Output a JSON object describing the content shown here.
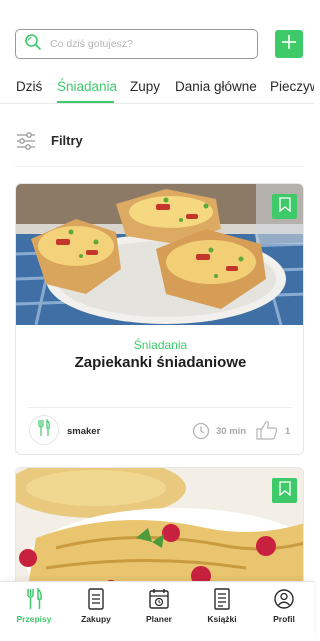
{
  "colors": {
    "accent": "#3fca6a",
    "text": "#222222",
    "muted": "#a8a8a8"
  },
  "search": {
    "placeholder": "Co dziś gotujesz?",
    "icon": "search-icon"
  },
  "header": {
    "add_icon": "plus-icon"
  },
  "tabs": [
    {
      "label": "Dziś",
      "active": false
    },
    {
      "label": "Śniadania",
      "active": true
    },
    {
      "label": "Zupy",
      "active": false
    },
    {
      "label": "Dania główne",
      "active": false
    },
    {
      "label": "Pieczywo",
      "active": false
    }
  ],
  "filters": {
    "label": "Filtry",
    "icon": "sliders-icon"
  },
  "recipes": [
    {
      "category": "Śniadania",
      "title": "Zapiekanki śniadaniowe",
      "author": "smaker",
      "time": "30 min",
      "likes": "1",
      "bookmark_icon": "bookmark-icon"
    },
    {
      "bookmark_icon": "bookmark-icon"
    }
  ],
  "bottom_nav": [
    {
      "label": "Przepisy",
      "icon": "cutlery-icon",
      "active": true
    },
    {
      "label": "Zakupy",
      "icon": "list-icon",
      "active": false
    },
    {
      "label": "Planer",
      "icon": "calendar-icon",
      "active": false
    },
    {
      "label": "Książki",
      "icon": "book-icon",
      "active": false
    },
    {
      "label": "Profil",
      "icon": "profile-icon",
      "active": false
    }
  ]
}
